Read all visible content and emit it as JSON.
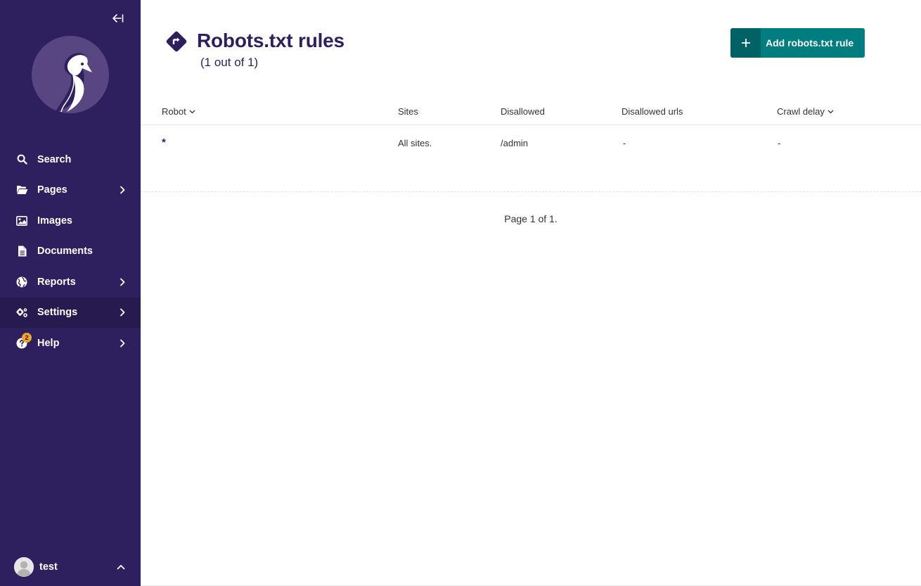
{
  "sidebar": {
    "items": [
      {
        "label": "Search",
        "icon": "search-icon"
      },
      {
        "label": "Pages",
        "icon": "folder-open-icon"
      },
      {
        "label": "Images",
        "icon": "image-icon"
      },
      {
        "label": "Documents",
        "icon": "document-icon"
      },
      {
        "label": "Reports",
        "icon": "globe-icon"
      },
      {
        "label": "Settings",
        "icon": "cogs-icon"
      },
      {
        "label": "Help",
        "icon": "help-icon",
        "badge": "2"
      }
    ],
    "account": {
      "name": "test"
    }
  },
  "header": {
    "title": "Robots.txt rules",
    "subtitle": "(1 out of 1)",
    "add_button": "Add robots.txt rule"
  },
  "table": {
    "columns": [
      "Robot",
      "Sites",
      "Disallowed",
      "Disallowed urls",
      "Crawl delay"
    ],
    "rows": [
      {
        "robot": "*",
        "sites": "All sites.",
        "disallowed": "/admin",
        "disallowed_urls": "-",
        "crawl_delay": "-"
      }
    ]
  },
  "pagination": "Page 1 of 1.",
  "colors": {
    "sidebar": "#2e1f5e",
    "accent": "#007d7e",
    "badge": "#f1a525"
  }
}
